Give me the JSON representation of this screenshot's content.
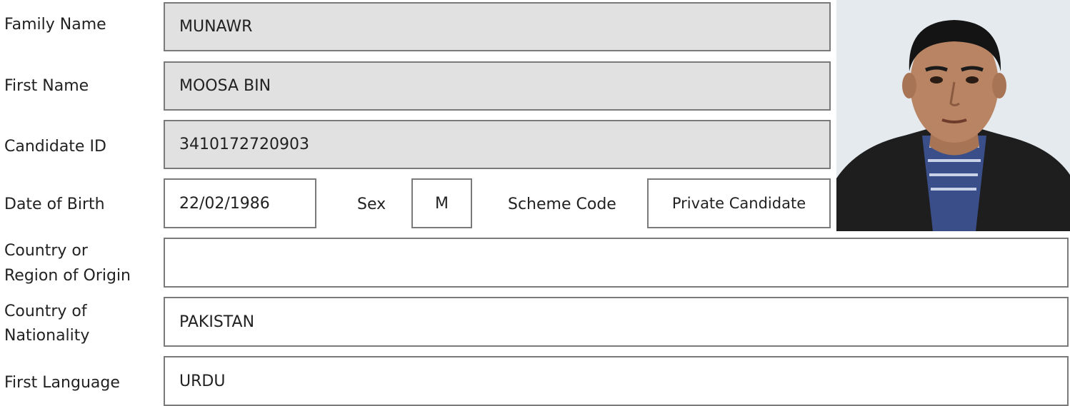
{
  "fields": {
    "family_name": {
      "label": "Family Name",
      "value": "MUNAWR"
    },
    "first_name": {
      "label": "First Name",
      "value": "MOOSA BIN"
    },
    "candidate_id": {
      "label": "Candidate ID",
      "value": "3410172720903"
    },
    "date_of_birth": {
      "label": "Date of Birth",
      "value": "22/02/1986"
    },
    "sex": {
      "label": "Sex",
      "value": "M"
    },
    "scheme_code": {
      "label": "Scheme Code",
      "value": "Private Candidate"
    },
    "country_origin": {
      "label_line1": "Country or",
      "label_line2": "Region of Origin",
      "value": ""
    },
    "country_nationality": {
      "label_line1": "Country of",
      "label_line2": "Nationality",
      "value": "PAKISTAN"
    },
    "first_language": {
      "label": "First Language",
      "value": "URDU"
    }
  },
  "photo": {
    "icon": "candidate-photo",
    "colors": {
      "background": "#e9eef2",
      "jacket": "#1e1e1e",
      "shirt": "#3a4f8a",
      "skin": "#b88463",
      "hair": "#141414"
    }
  }
}
